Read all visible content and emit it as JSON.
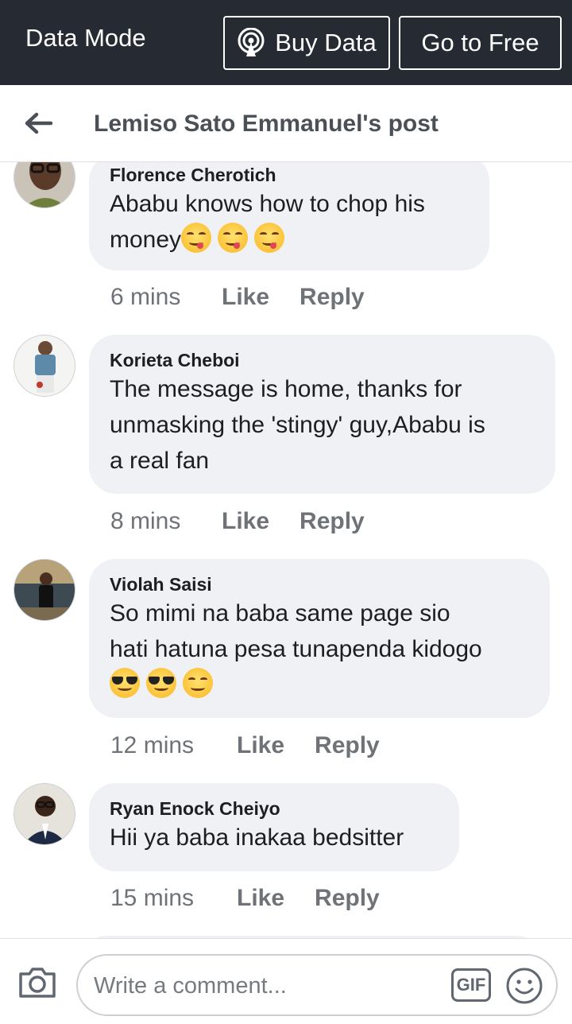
{
  "topbar": {
    "mode_label": "Data Mode",
    "buy_data_label": "Buy Data",
    "go_free_label": "Go to Free"
  },
  "header": {
    "title": "Lemiso Sato Emmanuel's post"
  },
  "comments": [
    {
      "author": "Florence Cherotich",
      "lines": [
        "Ababu knows how to chop his",
        "money"
      ],
      "emojis": [
        "face-savoring-food",
        "face-savoring-food",
        "face-savoring-food"
      ],
      "time": "6 mins",
      "like": "Like",
      "reply": "Reply"
    },
    {
      "author": "Korieta Cheboi",
      "lines": [
        "The message is home, thanks for",
        "unmasking the 'stingy' guy,Ababu is",
        "a real fan"
      ],
      "time": "8 mins",
      "like": "Like",
      "reply": "Reply"
    },
    {
      "author": "Violah Saisi",
      "lines": [
        "So mimi na baba same page sio",
        "hati hatuna pesa tunapenda kidogo"
      ],
      "emojis": [
        "smiling-face-with-sunglasses",
        "smiling-face-with-sunglasses",
        "relieved-face"
      ],
      "time": "12 mins",
      "like": "Like",
      "reply": "Reply"
    },
    {
      "author": "Ryan Enock Cheiyo",
      "lines": [
        "Hii ya baba inakaa bedsitter"
      ],
      "time": "15 mins",
      "like": "Like",
      "reply": "Reply"
    }
  ],
  "composer": {
    "placeholder": "Write a comment...",
    "gif_label": "GIF"
  },
  "colors": {
    "topbar_bg": "#262b33",
    "bubble_bg": "#f0f1f5",
    "meta_text": "#6f7378"
  }
}
